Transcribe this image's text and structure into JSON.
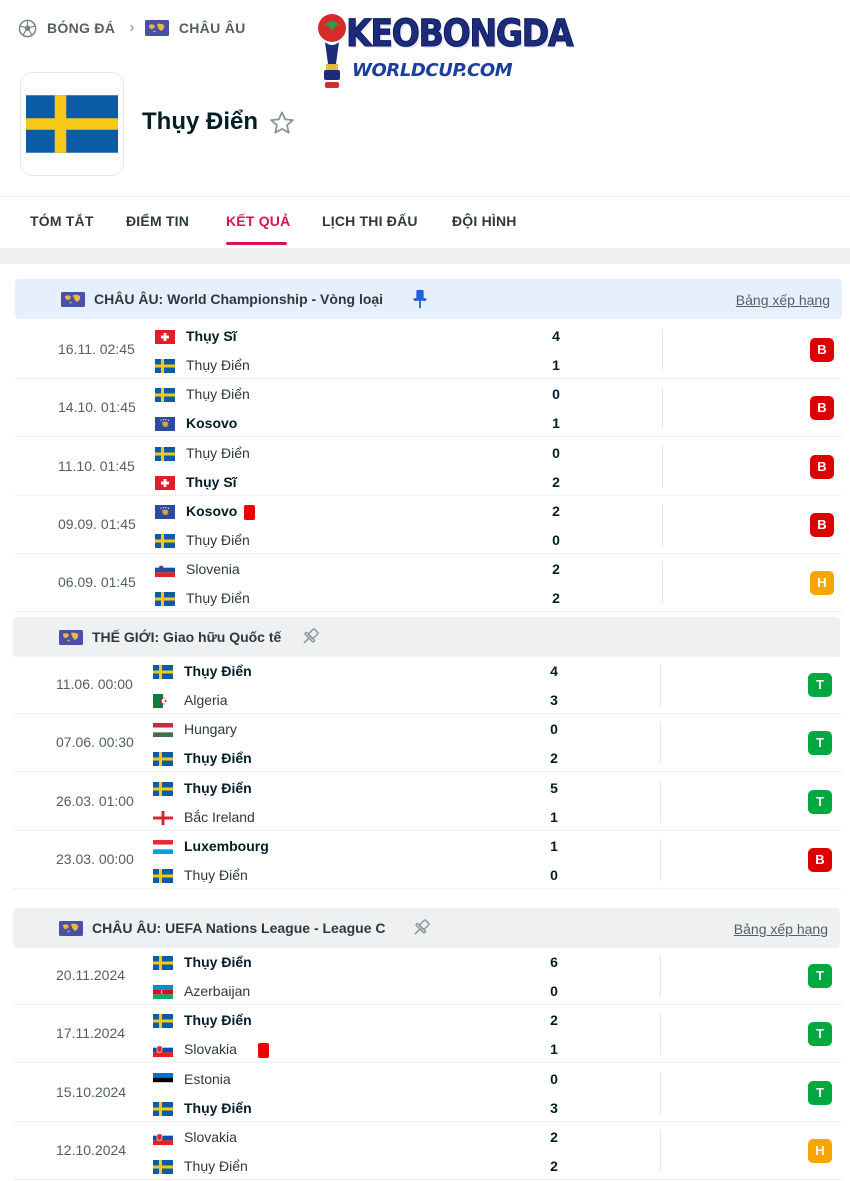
{
  "breadcrumb": {
    "sport": "BÓNG ĐÁ",
    "region": "CHÂU ÂU"
  },
  "logo": {
    "line1": "KEOBONGDA",
    "line2": "WORLDCUP.COM"
  },
  "team": {
    "name": "Thụy Điển"
  },
  "tabs": [
    "TÓM TẮT",
    "ĐIỂM TIN",
    "KẾT QUẢ",
    "LỊCH THI ĐẤU",
    "ĐỘI HÌNH"
  ],
  "active_tab": "KẾT QUẢ",
  "colors": {
    "accent": "#d7144b",
    "loss": "#dc0000",
    "win": "#00a83f",
    "draw": "#f7a600",
    "league_bg_pinned": "#e6f0fd",
    "league_bg": "#eef0f1"
  },
  "groups": [
    {
      "title": "CHÂU ÂU: World Championship - Vòng loại",
      "pinned": true,
      "standings_link": "Bảng xếp hạng",
      "matches": [
        {
          "time": "16.11. 02:45",
          "home": "Thụy Sĩ",
          "home_flag": "switzerland",
          "home_win": true,
          "home_score": "4",
          "away": "Thụy Điển",
          "away_flag": "sweden",
          "away_win": false,
          "away_score": "1",
          "result": "B"
        },
        {
          "time": "14.10. 01:45",
          "home": "Thụy Điển",
          "home_flag": "sweden",
          "home_win": false,
          "home_score": "0",
          "away": "Kosovo",
          "away_flag": "kosovo",
          "away_win": true,
          "away_score": "1",
          "result": "B"
        },
        {
          "time": "11.10. 01:45",
          "home": "Thụy Điển",
          "home_flag": "sweden",
          "home_win": false,
          "home_score": "0",
          "away": "Thụy Sĩ",
          "away_flag": "switzerland",
          "away_win": true,
          "away_score": "2",
          "result": "B"
        },
        {
          "time": "09.09. 01:45",
          "home": "Kosovo",
          "home_flag": "kosovo",
          "home_win": true,
          "home_red": true,
          "home_score": "2",
          "away": "Thụy Điển",
          "away_flag": "sweden",
          "away_win": false,
          "away_score": "0",
          "result": "B"
        },
        {
          "time": "06.09. 01:45",
          "home": "Slovenia",
          "home_flag": "slovenia",
          "home_win": false,
          "home_score": "2",
          "away": "Thụy Điển",
          "away_flag": "sweden",
          "away_win": false,
          "away_score": "2",
          "result": "H"
        }
      ]
    },
    {
      "title": "THẾ GIỚI: Giao hữu Quốc tế",
      "pinned": false,
      "standings_link": "",
      "matches": [
        {
          "time": "11.06. 00:00",
          "home": "Thụy Điển",
          "home_flag": "sweden",
          "home_win": true,
          "home_score": "4",
          "away": "Algeria",
          "away_flag": "algeria",
          "away_win": false,
          "away_score": "3",
          "result": "T"
        },
        {
          "time": "07.06. 00:30",
          "home": "Hungary",
          "home_flag": "hungary",
          "home_win": false,
          "home_score": "0",
          "away": "Thụy Điển",
          "away_flag": "sweden",
          "away_win": true,
          "away_score": "2",
          "result": "T"
        },
        {
          "time": "26.03. 01:00",
          "home": "Thụy Điển",
          "home_flag": "sweden",
          "home_win": true,
          "home_score": "5",
          "away": "Bắc Ireland",
          "away_flag": "northern-ireland",
          "away_win": false,
          "away_score": "1",
          "result": "T"
        },
        {
          "time": "23.03. 00:00",
          "home": "Luxembourg",
          "home_flag": "luxembourg",
          "home_win": true,
          "home_score": "1",
          "away": "Thụy Điển",
          "away_flag": "sweden",
          "away_win": false,
          "away_score": "0",
          "result": "B"
        }
      ]
    },
    {
      "title": "CHÂU ÂU: UEFA Nations League - League C",
      "pinned": false,
      "standings_link": "Bảng xếp hạng",
      "matches": [
        {
          "time": "20.11.2024",
          "home": "Thụy Điển",
          "home_flag": "sweden",
          "home_win": true,
          "home_score": "6",
          "away": "Azerbaijan",
          "away_flag": "azerbaijan",
          "away_win": false,
          "away_score": "0",
          "result": "T"
        },
        {
          "time": "17.11.2024",
          "home": "Thụy Điển",
          "home_flag": "sweden",
          "home_win": true,
          "home_score": "2",
          "away": "Slovakia",
          "away_flag": "slovakia",
          "away_win": false,
          "away_red": true,
          "away_score": "1",
          "result": "T"
        },
        {
          "time": "15.10.2024",
          "home": "Estonia",
          "home_flag": "estonia",
          "home_win": false,
          "home_score": "0",
          "away": "Thụy Điển",
          "away_flag": "sweden",
          "away_win": true,
          "away_score": "3",
          "result": "T"
        },
        {
          "time": "12.10.2024",
          "home": "Slovakia",
          "home_flag": "slovakia",
          "home_win": false,
          "home_score": "2",
          "away": "Thụy Điển",
          "away_flag": "sweden",
          "away_win": false,
          "away_score": "2",
          "result": "H"
        }
      ]
    }
  ]
}
